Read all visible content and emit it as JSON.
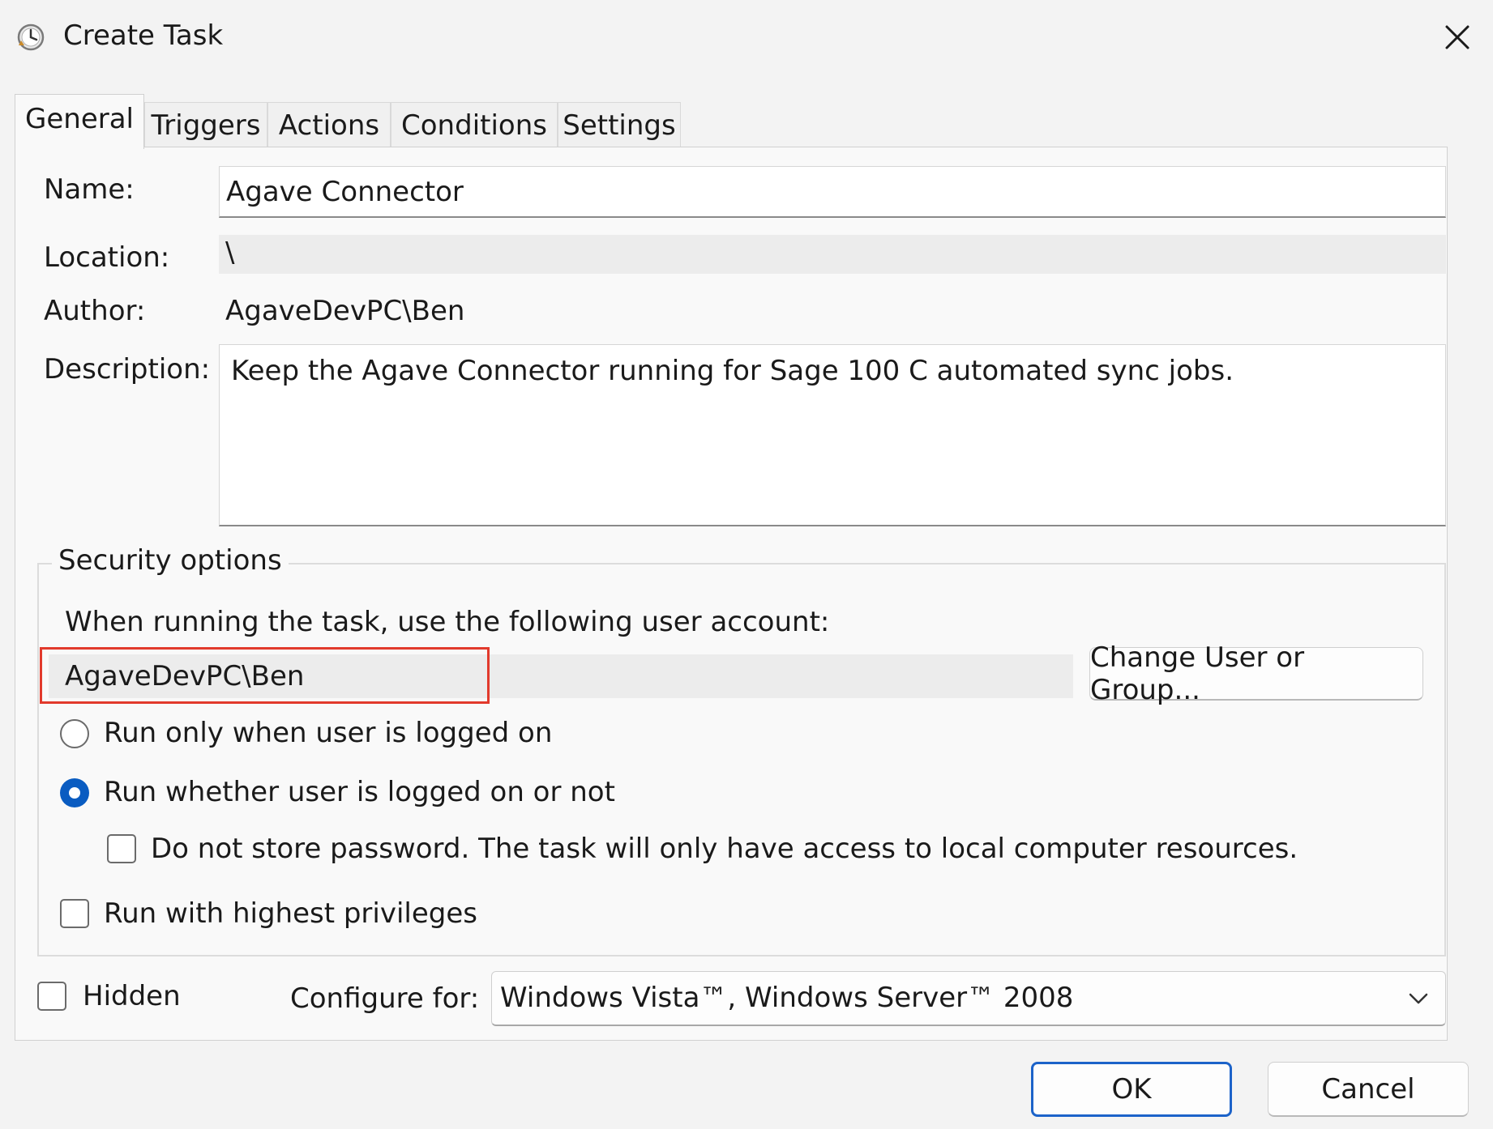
{
  "window": {
    "title": "Create Task"
  },
  "tabs": [
    {
      "label": "General",
      "active": true
    },
    {
      "label": "Triggers",
      "active": false
    },
    {
      "label": "Actions",
      "active": false
    },
    {
      "label": "Conditions",
      "active": false
    },
    {
      "label": "Settings",
      "active": false
    }
  ],
  "general": {
    "name_label": "Name:",
    "name_value": "Agave Connector",
    "location_label": "Location:",
    "location_value": "\\",
    "author_label": "Author:",
    "author_value": "AgaveDevPC\\Ben",
    "description_label": "Description:",
    "description_value": "Keep the Agave Connector running for Sage 100 C automated sync jobs."
  },
  "security": {
    "legend": "Security options",
    "account_prompt": "When running the task, use the following user account:",
    "account_value": "AgaveDevPC\\Ben",
    "change_user_button": "Change User or Group...",
    "radio_logged_on": {
      "label": "Run only when user is logged on",
      "checked": false
    },
    "radio_whether": {
      "label": "Run whether user is logged on or not",
      "checked": true
    },
    "no_password": {
      "label": "Do not store password.  The task will only have access to local computer resources.",
      "checked": false
    },
    "highest_privileges": {
      "label": "Run with highest privileges",
      "checked": false
    }
  },
  "footer": {
    "hidden": {
      "label": "Hidden",
      "checked": false
    },
    "configure_label": "Configure for:",
    "configure_value": "Windows Vista™, Windows Server™ 2008"
  },
  "buttons": {
    "ok": "OK",
    "cancel": "Cancel"
  },
  "colors": {
    "accent": "#0a5cc1",
    "highlight": "#e23a2c"
  }
}
